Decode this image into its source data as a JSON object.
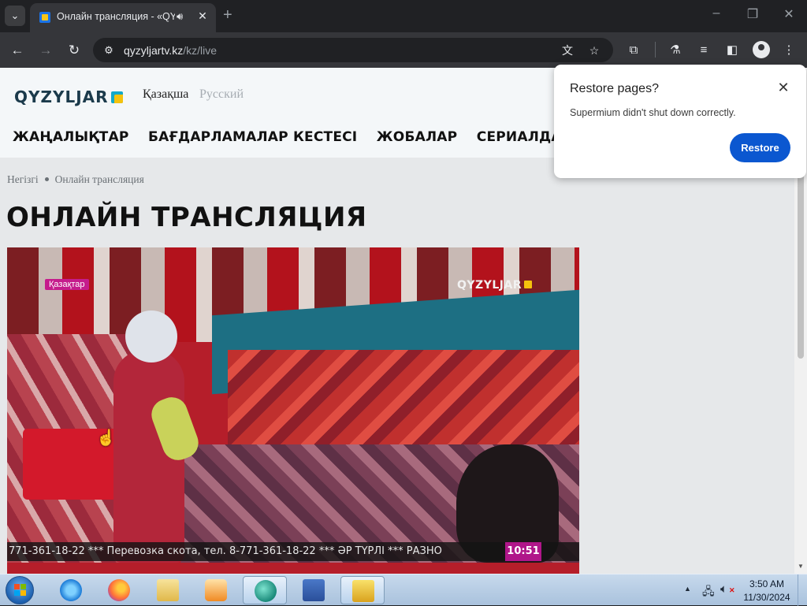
{
  "browser": {
    "tab_title": "Онлайн трансляция - «QY",
    "url_host": "qyzyljartv.kz",
    "url_path": "/kz/live"
  },
  "site": {
    "logo": "QYZYLJAR",
    "lang_active": "Қазақша",
    "lang_other": "Русский",
    "nav": [
      "ЖАҢАЛЫҚТАР",
      "БАҒДАРЛАМАЛАР КЕСТЕСІ",
      "ЖОБАЛАР",
      "СЕРИАЛДАР"
    ],
    "breadcrumb": [
      "Негізгі",
      "Онлайн трансляция"
    ],
    "page_title": "ОНЛАЙН ТРАНСЛЯЦИЯ"
  },
  "video": {
    "channel_badge": "Қазақтар",
    "channel_logo": "QYZYLJAR",
    "ticker": "771-361-18-22 *** Перевозка скота, тел. 8-771-361-18-22 *** ӘР ТҮРЛІ *** РАЗНО",
    "clock": "10:51"
  },
  "popup": {
    "title": "Restore pages?",
    "message": "Supermium didn't shut down correctly.",
    "button": "Restore"
  },
  "taskbar": {
    "time": "3:50 AM",
    "date": "11/30/2024"
  },
  "colors": {
    "brand_teal": "#12a9c9",
    "brand_yellow": "#f4c20d",
    "restore_button": "#0b57d0",
    "ticker_clock": "#b0168a"
  },
  "icons": [
    "tab-search-icon",
    "audio-icon",
    "close-icon",
    "new-tab-icon",
    "minimize-icon",
    "maximize-icon",
    "back-icon",
    "forward-icon",
    "reload-icon",
    "site-info-icon",
    "translate-icon",
    "star-icon",
    "extensions-icon",
    "labs-icon",
    "media-icon",
    "sidepanel-icon",
    "profile-icon",
    "menu-icon"
  ]
}
